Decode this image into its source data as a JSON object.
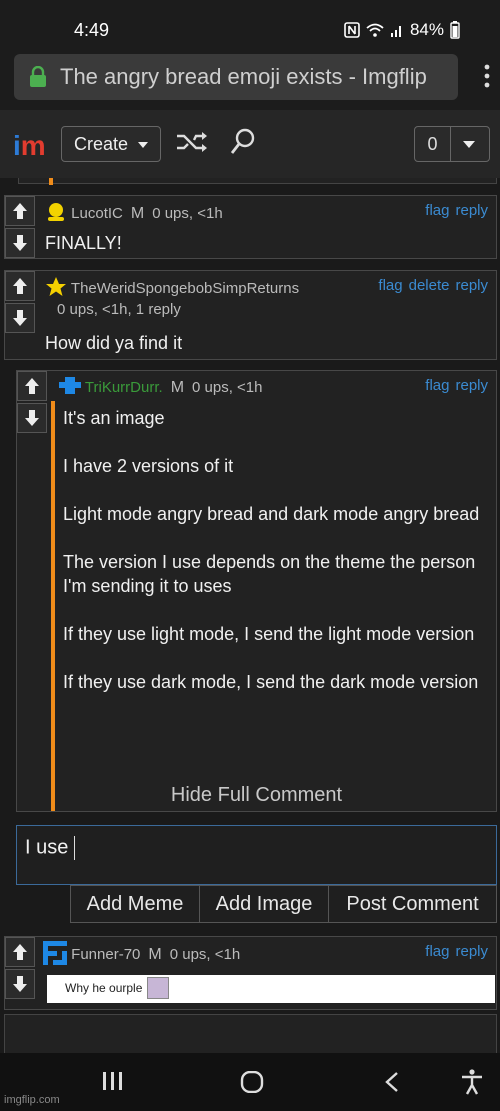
{
  "status": {
    "time": "4:49",
    "battery": "84%"
  },
  "browser": {
    "url_title": "The angry bread emoji exists - Imgflip"
  },
  "header": {
    "create_label": "Create",
    "notif_count": "0"
  },
  "comments": [
    {
      "username": "LucotIC",
      "badge": "M",
      "meta": "0 ups, <1h",
      "actions": [
        "flag",
        "reply"
      ],
      "text": "FINALLY!"
    },
    {
      "username": "TheWeridSpongebobSimpReturns",
      "meta": "0 ups, <1h, 1 reply",
      "actions": [
        "flag",
        "delete",
        "reply"
      ],
      "text": "How did ya find it"
    },
    {
      "username": "TriKurrDurr.",
      "badge": "M",
      "meta": "0 ups, <1h",
      "actions": [
        "flag",
        "reply"
      ],
      "paragraphs": [
        "It's an image",
        "I have 2 versions of it",
        "Light mode angry bread and dark mode angry bread",
        "The version I use depends on the theme the person I'm sending it to uses",
        "If they use light mode, I send the light mode version",
        "If they use dark mode, I send the dark mode version"
      ],
      "hide_label": "Hide Full Comment"
    },
    {
      "username": "Funner-70",
      "badge": "M",
      "meta": "0 ups, <1h",
      "actions": [
        "flag",
        "reply"
      ],
      "image_caption": "Why he ourple"
    }
  ],
  "reply": {
    "value": "I use",
    "buttons": [
      "Add Meme",
      "Add Image",
      "Post Comment"
    ]
  },
  "watermark": "imgflip.com"
}
